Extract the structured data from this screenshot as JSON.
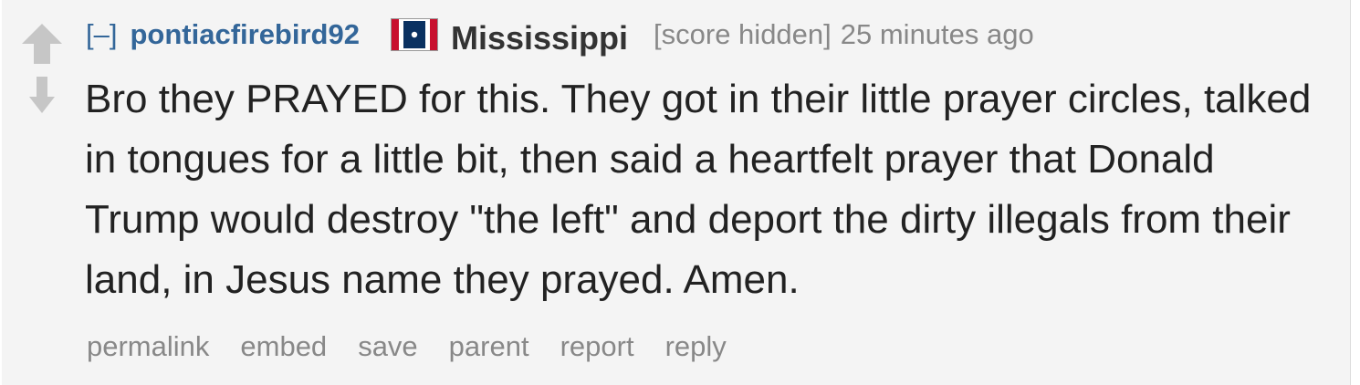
{
  "comment": {
    "collapse_label": "[–]",
    "author": "pontiacfirebird92",
    "flair": {
      "icon": "mississippi-flag-icon",
      "text": "Mississippi"
    },
    "score": "[score hidden]",
    "time": "25 minutes ago",
    "body": "Bro they PRAYED for this. They got in their little prayer circles, talked in tongues for a little bit, then said a heartfelt prayer that Donald Trump would destroy \"the left\" and deport the dirty illegals from their land, in Jesus name they prayed. Amen.",
    "buttons": [
      "permalink",
      "embed",
      "save",
      "parent",
      "report",
      "reply"
    ]
  },
  "colors": {
    "background": "#f4f4f4",
    "author": "#336699",
    "meta": "#888888",
    "text": "#222222",
    "vote_arrow": "#c6c6c6"
  }
}
